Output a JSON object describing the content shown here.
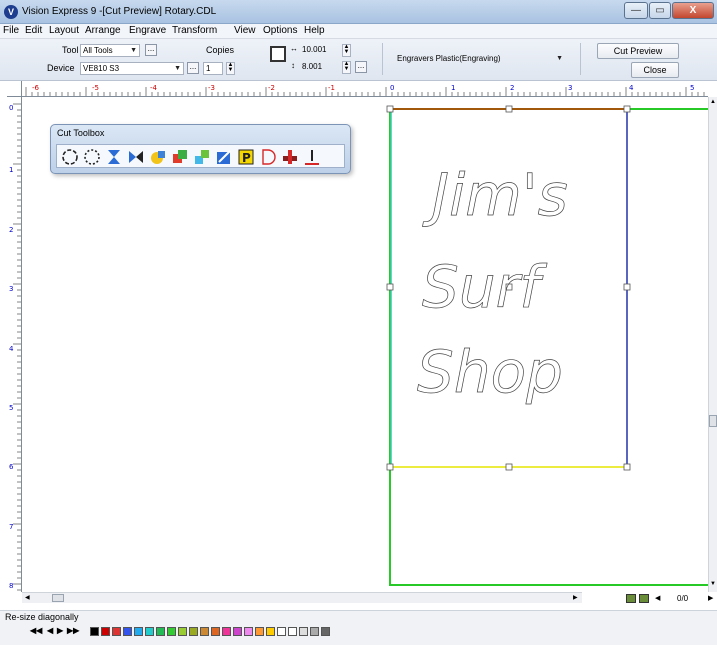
{
  "window": {
    "title": "Vision Express 9 -[Cut Preview] Rotary.CDL",
    "minimize_glyph": "—",
    "restore_glyph": "▭",
    "close_glyph": "X"
  },
  "menu": [
    "File",
    "Edit",
    "Layout",
    "Arrange",
    "Engrave",
    "Transform",
    "View",
    "Options",
    "Help"
  ],
  "toolbar": {
    "tool_label": "Tool",
    "tool_value": "All Tools",
    "device_label": "Device",
    "device_value": "VE810 S3",
    "ellipsis": "...",
    "copies_label": "Copies",
    "copies_value": "1",
    "width_value": "10.001",
    "height_value": "8.001",
    "material_value": "Engravers Plastic(Engraving)",
    "cut_preview_label": "Cut Preview",
    "close_label": "Close"
  },
  "rulers": {
    "horizontal_labels": [
      "-6",
      "-5",
      "-4",
      "-3",
      "-2",
      "-1",
      "0",
      "1",
      "2",
      "3",
      "4",
      "5"
    ],
    "vertical_labels": [
      "0",
      "1",
      "2",
      "3",
      "4",
      "5",
      "6",
      "7",
      "8"
    ]
  },
  "toolbox": {
    "title": "Cut Toolbox",
    "tools": [
      "circle-select-icon",
      "circle-dashed-icon",
      "flip-vertical-icon",
      "flip-horizontal-icon",
      "weld-icon",
      "overlap-icon",
      "puzzle-icon",
      "color-fill-icon",
      "p-letter-icon",
      "d-shape-icon",
      "cutter-icon",
      "inline-icon"
    ]
  },
  "canvas": {
    "line1": "Jim's",
    "line2": "Surf",
    "line3": "Shop"
  },
  "status": {
    "text": "Re-size diagonally",
    "page_indicator": "0/0"
  },
  "colors": {
    "page_border": "#26c926",
    "top_edge": "#cc3300",
    "left_edge": "#33ccaa",
    "right_edge": "#2233aa",
    "bottom_edge": "#e6e600"
  },
  "palette": [
    "#000000",
    "#cc0000",
    "#dd3333",
    "#3355ee",
    "#22aaee",
    "#22cccc",
    "#22bb55",
    "#33cc33",
    "#99cc33",
    "#99aa22",
    "#cc8833",
    "#dd6622",
    "#ee3399",
    "#cc44cc",
    "#ee88ee",
    "#ff9933",
    "#ffcc00",
    "#ffffff",
    "#ffffff",
    "#dddddd",
    "#aaaaaa",
    "#666666"
  ]
}
